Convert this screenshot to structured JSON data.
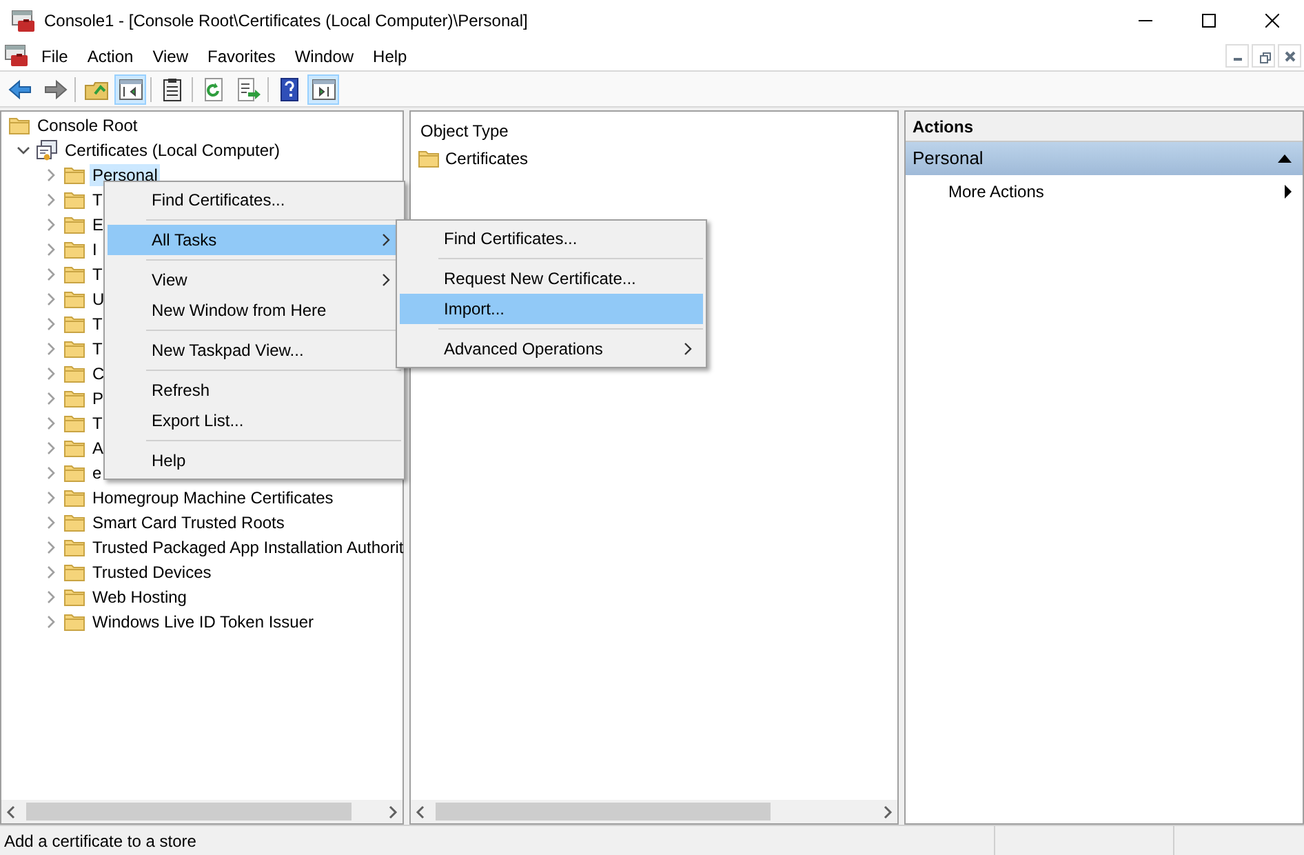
{
  "window": {
    "title": "Console1 - [Console Root\\Certificates (Local Computer)\\Personal]"
  },
  "menu_bar": [
    "File",
    "Action",
    "View",
    "Favorites",
    "Window",
    "Help"
  ],
  "toolbar": [
    {
      "kind": "back",
      "pressed": false
    },
    {
      "kind": "forward",
      "pressed": false
    },
    {
      "kind": "sep"
    },
    {
      "kind": "up",
      "pressed": false
    },
    {
      "kind": "tree",
      "pressed": true
    },
    {
      "kind": "sep"
    },
    {
      "kind": "clipboard",
      "pressed": false
    },
    {
      "kind": "sep"
    },
    {
      "kind": "refresh",
      "pressed": false
    },
    {
      "kind": "export",
      "pressed": false
    },
    {
      "kind": "sep"
    },
    {
      "kind": "help",
      "pressed": false
    },
    {
      "kind": "actionpane",
      "pressed": true
    }
  ],
  "tree": [
    {
      "label": "Console Root",
      "kind": "folder",
      "selected": false,
      "children": [
        {
          "label": "Certificates (Local Computer)",
          "kind": "store",
          "expanded": true,
          "selected": false,
          "children": [
            {
              "label": "Personal",
              "kind": "folder",
              "expanded": false,
              "selected": true
            },
            {
              "label": "T",
              "kind": "folder",
              "expanded": false,
              "selected": false
            },
            {
              "label": "E",
              "kind": "folder",
              "expanded": false,
              "selected": false
            },
            {
              "label": "I",
              "kind": "folder",
              "expanded": false,
              "selected": false
            },
            {
              "label": "T",
              "kind": "folder",
              "expanded": false,
              "selected": false
            },
            {
              "label": "U",
              "kind": "folder",
              "expanded": false,
              "selected": false
            },
            {
              "label": "T",
              "kind": "folder",
              "expanded": false,
              "selected": false
            },
            {
              "label": "T",
              "kind": "folder",
              "expanded": false,
              "selected": false
            },
            {
              "label": "C",
              "kind": "folder",
              "expanded": false,
              "selected": false
            },
            {
              "label": "P",
              "kind": "folder",
              "expanded": false,
              "selected": false
            },
            {
              "label": "T",
              "kind": "folder",
              "expanded": false,
              "selected": false
            },
            {
              "label": "A",
              "kind": "folder",
              "expanded": false,
              "selected": false
            },
            {
              "label": "e",
              "kind": "folder",
              "expanded": false,
              "selected": false
            },
            {
              "label": "Homegroup Machine Certificates",
              "kind": "folder",
              "expanded": false,
              "selected": false
            },
            {
              "label": "Smart Card Trusted Roots",
              "kind": "folder",
              "expanded": false,
              "selected": false
            },
            {
              "label": "Trusted Packaged App Installation Authorit",
              "kind": "folder",
              "expanded": false,
              "selected": false
            },
            {
              "label": "Trusted Devices",
              "kind": "folder",
              "expanded": false,
              "selected": false
            },
            {
              "label": "Web Hosting",
              "kind": "folder",
              "expanded": false,
              "selected": false
            },
            {
              "label": "Windows Live ID Token Issuer",
              "kind": "folder",
              "expanded": false,
              "selected": false
            }
          ]
        }
      ]
    }
  ],
  "list": {
    "columns": [
      "Object Type"
    ],
    "rows": [
      "Certificates"
    ]
  },
  "actions": {
    "title": "Actions",
    "section": "Personal",
    "expanded": true,
    "items": [
      {
        "label": "More Actions",
        "submenu": true
      }
    ]
  },
  "context_menu": [
    {
      "kind": "item",
      "label": "Find Certificates...",
      "selected": false,
      "submenu": false
    },
    {
      "kind": "separator"
    },
    {
      "kind": "item",
      "label": "All Tasks",
      "selected": true,
      "submenu": true
    },
    {
      "kind": "separator"
    },
    {
      "kind": "item",
      "label": "View",
      "selected": false,
      "submenu": true
    },
    {
      "kind": "item",
      "label": "New Window from Here",
      "selected": false,
      "submenu": false
    },
    {
      "kind": "separator"
    },
    {
      "kind": "item",
      "label": "New Taskpad View...",
      "selected": false,
      "submenu": false
    },
    {
      "kind": "separator"
    },
    {
      "kind": "item",
      "label": "Refresh",
      "selected": false,
      "submenu": false
    },
    {
      "kind": "item",
      "label": "Export List...",
      "selected": false,
      "submenu": false
    },
    {
      "kind": "separator"
    },
    {
      "kind": "item",
      "label": "Help",
      "selected": false,
      "submenu": false
    }
  ],
  "submenu": [
    {
      "kind": "item",
      "label": "Find Certificates...",
      "selected": false,
      "submenu": false
    },
    {
      "kind": "separator"
    },
    {
      "kind": "item",
      "label": "Request New Certificate...",
      "selected": false,
      "submenu": false
    },
    {
      "kind": "item",
      "label": "Import...",
      "selected": true,
      "submenu": false
    },
    {
      "kind": "separator"
    },
    {
      "kind": "item",
      "label": "Advanced Operations",
      "selected": false,
      "submenu": true
    }
  ],
  "status_bar": [
    "Add a certificate to a store"
  ]
}
